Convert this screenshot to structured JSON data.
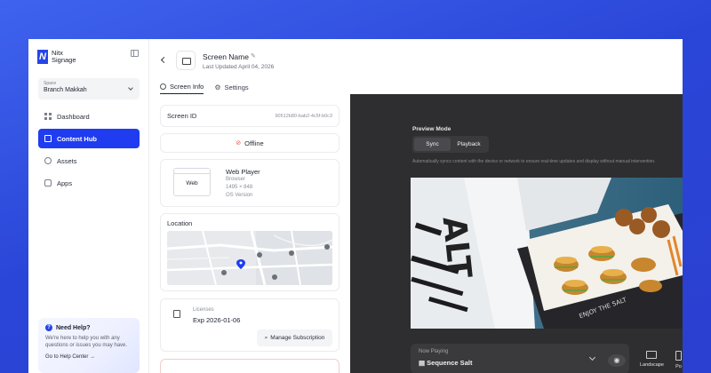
{
  "sidebar": {
    "logo_line1": "Nitx",
    "logo_line2": "Signage",
    "space_label": "Space",
    "space_value": "Branch Makkah",
    "nav": [
      {
        "label": "Dashboard",
        "icon": "grid-icon"
      },
      {
        "label": "Content Hub",
        "icon": "content-hub-icon"
      },
      {
        "label": "Assets",
        "icon": "assets-icon"
      },
      {
        "label": "Apps",
        "icon": "apps-icon"
      }
    ],
    "help_title": "Need Help?",
    "help_desc": "We're here to help you with any questions or issues you may have.",
    "help_link": "Go to Help Center →"
  },
  "header": {
    "screen_name": "Screen Name",
    "last_updated": "Last Updated April 04, 2026",
    "tabs": [
      {
        "label": "Screen Info"
      },
      {
        "label": "Settings"
      }
    ]
  },
  "info": {
    "screen_id_label": "Screen ID",
    "screen_id_value": "90512b80-bab2-4c5f-b0c3",
    "status": "Offline",
    "player_thumb": "Web",
    "player_title": "Web Player",
    "player_type": "Browser",
    "player_res": "1495 × 848",
    "player_os": "OS Version",
    "location_label": "Location",
    "license_label": "Licenses",
    "license_value": "Exp 2026-01-06",
    "manage_sub": "Manage Subscription"
  },
  "preview": {
    "mode_label": "Preview Mode",
    "mode_options": [
      "Sync",
      "Playback"
    ],
    "selected_mode": "Sync",
    "description": "Automatically syncs content with the device or network to ensure real-time updates and display without manual intervention.",
    "now_playing_label": "Now Playing",
    "now_playing_value": "Sequence Salt",
    "orientation_landscape": "Landscape",
    "orientation_portrait": "Po"
  },
  "colors": {
    "accent": "#1f3cf0",
    "background": "#3f63ee",
    "preview_bg": "#2e2e30",
    "offline": "#e8554b"
  }
}
